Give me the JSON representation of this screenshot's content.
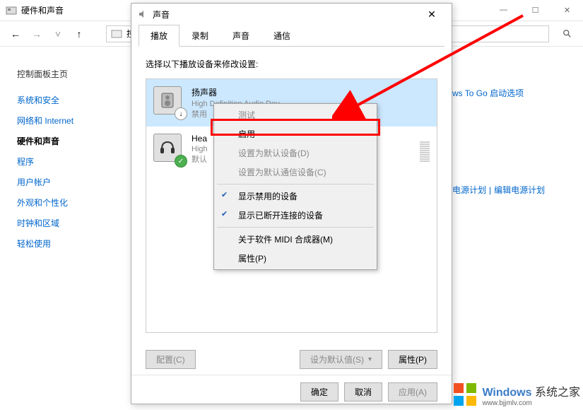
{
  "explorer": {
    "title": "硬件和声音",
    "breadcrumb": "控制面",
    "win_min": "—",
    "win_max": "☐",
    "win_close": "✕"
  },
  "sidebar": {
    "heading": "控制面板主页",
    "items": [
      "系统和安全",
      "网络和 Internet",
      "硬件和声音",
      "程序",
      "用户帐户",
      "外观和个性化",
      "时钟和区域",
      "轻松使用"
    ]
  },
  "content": {
    "link1": "ws To Go 启动选项",
    "link2": "电源计划",
    "link3": "编辑电源计划"
  },
  "dialog": {
    "title": "声音",
    "tabs": [
      "播放",
      "录制",
      "声音",
      "通信"
    ],
    "instruction": "选择以下播放设备来修改设置:",
    "devices": [
      {
        "name": "扬声器",
        "desc": "High Definition Audio Dev",
        "status": "禁用"
      },
      {
        "name": "Hea",
        "desc": "High",
        "status": "默认"
      }
    ],
    "btn_config": "配置(C)",
    "btn_default": "设为默认值(S)",
    "btn_props": "属性(P)",
    "btn_ok": "确定",
    "btn_cancel": "取消",
    "btn_apply": "应用(A)"
  },
  "menu": {
    "items": [
      {
        "label": "测试",
        "disabled": true
      },
      {
        "label": "启用",
        "highlighted": true
      },
      {
        "label": "设置为默认设备(D)",
        "disabled": true
      },
      {
        "label": "设置为默认通信设备(C)",
        "disabled": true
      },
      {
        "sep": true
      },
      {
        "label": "显示禁用的设备",
        "checked": true
      },
      {
        "label": "显示已断开连接的设备",
        "checked": true
      },
      {
        "sep": true
      },
      {
        "label": "关于软件 MIDI 合成器(M)"
      },
      {
        "label": "属性(P)"
      }
    ]
  },
  "watermark": {
    "brand": "Windows",
    "brand2": "系统之家",
    "url": "www.bjjmlv.com"
  }
}
